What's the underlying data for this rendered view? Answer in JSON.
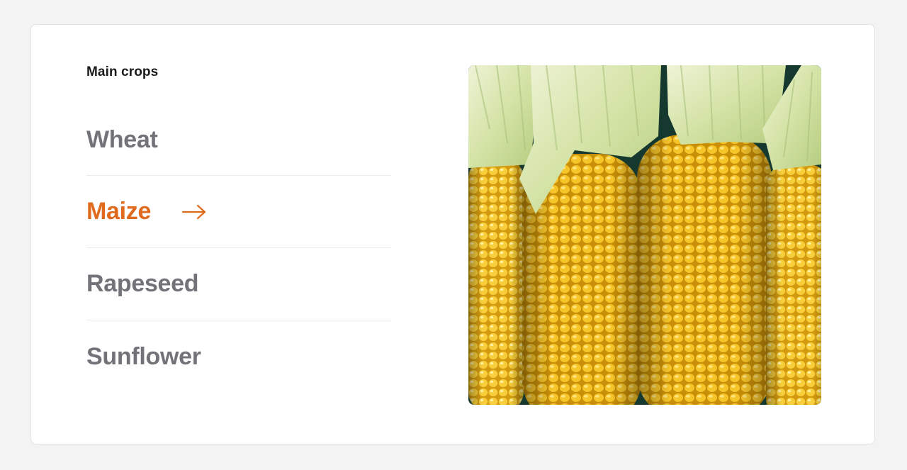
{
  "section": {
    "title": "Main crops"
  },
  "crops": [
    {
      "label": "Wheat",
      "active": false
    },
    {
      "label": "Maize",
      "active": true
    },
    {
      "label": "Rapeseed",
      "active": false
    },
    {
      "label": "Sunflower",
      "active": false
    }
  ],
  "colors": {
    "accent": "#e06b1f",
    "inactive_text": "#727279",
    "heading": "#1a1a1a",
    "divider": "#ececef"
  },
  "image": {
    "subject": "corn-cobs-photo",
    "ear_count": 4
  }
}
